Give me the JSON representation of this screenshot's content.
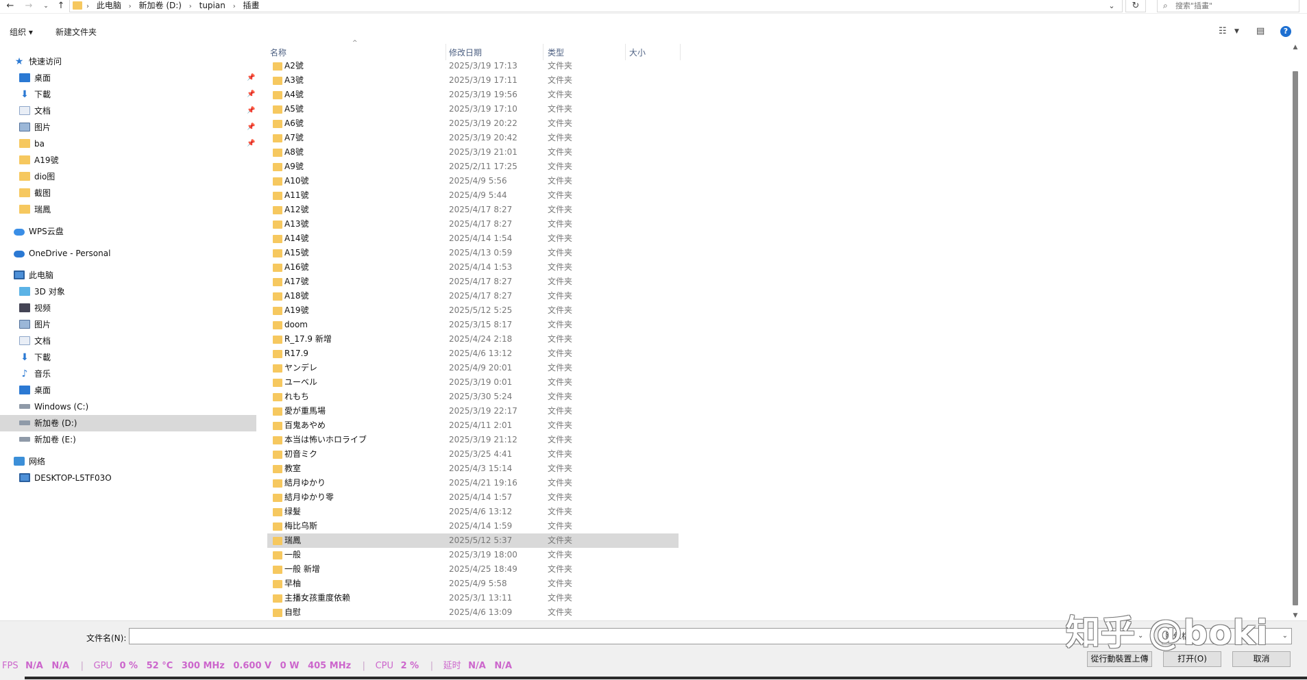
{
  "address": {
    "crumbs": [
      "此电脑",
      "新加卷 (D:)",
      "tupian",
      "插畫"
    ],
    "search_placeholder": "搜索\"插畫\""
  },
  "toolbar": {
    "organize": "组织 ▾",
    "new_folder": "新建文件夹"
  },
  "nav": {
    "quick_access": "快速访问",
    "quick_items": [
      "桌面",
      "下載",
      "文档",
      "图片",
      "ba",
      "A19號",
      "dio图",
      "截图",
      "瑞鳳"
    ],
    "wps": "WPS云盘",
    "onedrive": "OneDrive - Personal",
    "this_pc": "此电脑",
    "pc_items": [
      "3D 对象",
      "视频",
      "图片",
      "文档",
      "下載",
      "音乐",
      "桌面",
      "Windows (C:)",
      "新加卷 (D:)",
      "新加卷 (E:)"
    ],
    "network": "网络",
    "network_items": [
      "DESKTOP-L5TF03O"
    ]
  },
  "columns": {
    "name": "名称",
    "date": "修改日期",
    "type": "类型",
    "size": "大小"
  },
  "files": [
    {
      "name": "A2號",
      "date": "2025/3/19 17:13",
      "type": "文件夹"
    },
    {
      "name": "A3號",
      "date": "2025/3/19 17:11",
      "type": "文件夹"
    },
    {
      "name": "A4號",
      "date": "2025/3/19 19:56",
      "type": "文件夹"
    },
    {
      "name": "A5號",
      "date": "2025/3/19 17:10",
      "type": "文件夹"
    },
    {
      "name": "A6號",
      "date": "2025/3/19 20:22",
      "type": "文件夹"
    },
    {
      "name": "A7號",
      "date": "2025/3/19 20:42",
      "type": "文件夹"
    },
    {
      "name": "A8號",
      "date": "2025/3/19 21:01",
      "type": "文件夹"
    },
    {
      "name": "A9號",
      "date": "2025/2/11 17:25",
      "type": "文件夹"
    },
    {
      "name": "A10號",
      "date": "2025/4/9 5:56",
      "type": "文件夹"
    },
    {
      "name": "A11號",
      "date": "2025/4/9 5:44",
      "type": "文件夹"
    },
    {
      "name": "A12號",
      "date": "2025/4/17 8:27",
      "type": "文件夹"
    },
    {
      "name": "A13號",
      "date": "2025/4/17 8:27",
      "type": "文件夹"
    },
    {
      "name": "A14號",
      "date": "2025/4/14 1:54",
      "type": "文件夹"
    },
    {
      "name": "A15號",
      "date": "2025/4/13 0:59",
      "type": "文件夹"
    },
    {
      "name": "A16號",
      "date": "2025/4/14 1:53",
      "type": "文件夹"
    },
    {
      "name": "A17號",
      "date": "2025/4/17 8:27",
      "type": "文件夹"
    },
    {
      "name": "A18號",
      "date": "2025/4/17 8:27",
      "type": "文件夹"
    },
    {
      "name": "A19號",
      "date": "2025/5/12 5:25",
      "type": "文件夹"
    },
    {
      "name": "doom",
      "date": "2025/3/15 8:17",
      "type": "文件夹"
    },
    {
      "name": "R_17.9  新增",
      "date": "2025/4/24 2:18",
      "type": "文件夹"
    },
    {
      "name": "R17.9",
      "date": "2025/4/6 13:12",
      "type": "文件夹"
    },
    {
      "name": "ヤンデレ",
      "date": "2025/4/9 20:01",
      "type": "文件夹"
    },
    {
      "name": "ユーベル",
      "date": "2025/3/19 0:01",
      "type": "文件夹"
    },
    {
      "name": "れもち",
      "date": "2025/3/30 5:24",
      "type": "文件夹"
    },
    {
      "name": "愛が重馬場",
      "date": "2025/3/19 22:17",
      "type": "文件夹"
    },
    {
      "name": "百鬼あやめ",
      "date": "2025/4/11 2:01",
      "type": "文件夹"
    },
    {
      "name": "本当は怖いホロライブ",
      "date": "2025/3/19 21:12",
      "type": "文件夹"
    },
    {
      "name": "初音ミク",
      "date": "2025/3/25 4:41",
      "type": "文件夹"
    },
    {
      "name": "教室",
      "date": "2025/4/3 15:14",
      "type": "文件夹"
    },
    {
      "name": "結月ゆかり",
      "date": "2025/4/21 19:16",
      "type": "文件夹"
    },
    {
      "name": "結月ゆかり零",
      "date": "2025/4/14 1:57",
      "type": "文件夹"
    },
    {
      "name": "绿髮",
      "date": "2025/4/6 13:12",
      "type": "文件夹"
    },
    {
      "name": "梅比乌斯",
      "date": "2025/4/14 1:59",
      "type": "文件夹"
    },
    {
      "name": "瑞鳳",
      "date": "2025/5/12 5:37",
      "type": "文件夹"
    },
    {
      "name": "一般",
      "date": "2025/3/19 18:00",
      "type": "文件夹"
    },
    {
      "name": "一般 新增",
      "date": "2025/4/25 18:49",
      "type": "文件夹"
    },
    {
      "name": "早柚",
      "date": "2025/4/9 5:58",
      "type": "文件夹"
    },
    {
      "name": "主播女孩重度依赖",
      "date": "2025/3/1 13:11",
      "type": "文件夹"
    },
    {
      "name": "自慰",
      "date": "2025/4/6 13:09",
      "type": "文件夹"
    }
  ],
  "selected_file": "瑞鳳",
  "bottom": {
    "filename_label": "文件名(N):",
    "filename_value": "",
    "filter_value": "影像檔",
    "upload_button": "從行動裝置上傳",
    "open_button": "打开(O)",
    "cancel_button": "取消"
  },
  "hud": {
    "fps_label": "FPS",
    "fps_vals": [
      "N/A",
      "N/A"
    ],
    "gpu_label": "GPU",
    "gpu_vals": [
      "0 %",
      "52 °C",
      "300 MHz",
      "0.600 V",
      "0 W",
      "405 MHz"
    ],
    "cpu_label": "CPU",
    "cpu_vals": [
      "2 %"
    ],
    "lat_label": "延时",
    "lat_vals": [
      "N/A",
      "N/A"
    ]
  },
  "watermark": "知乎 @boki",
  "colors": {
    "folder": "#f6c85f",
    "selection": "#d9d9d9",
    "accent": "#1d6fd1",
    "hud": "#cc66cc"
  }
}
